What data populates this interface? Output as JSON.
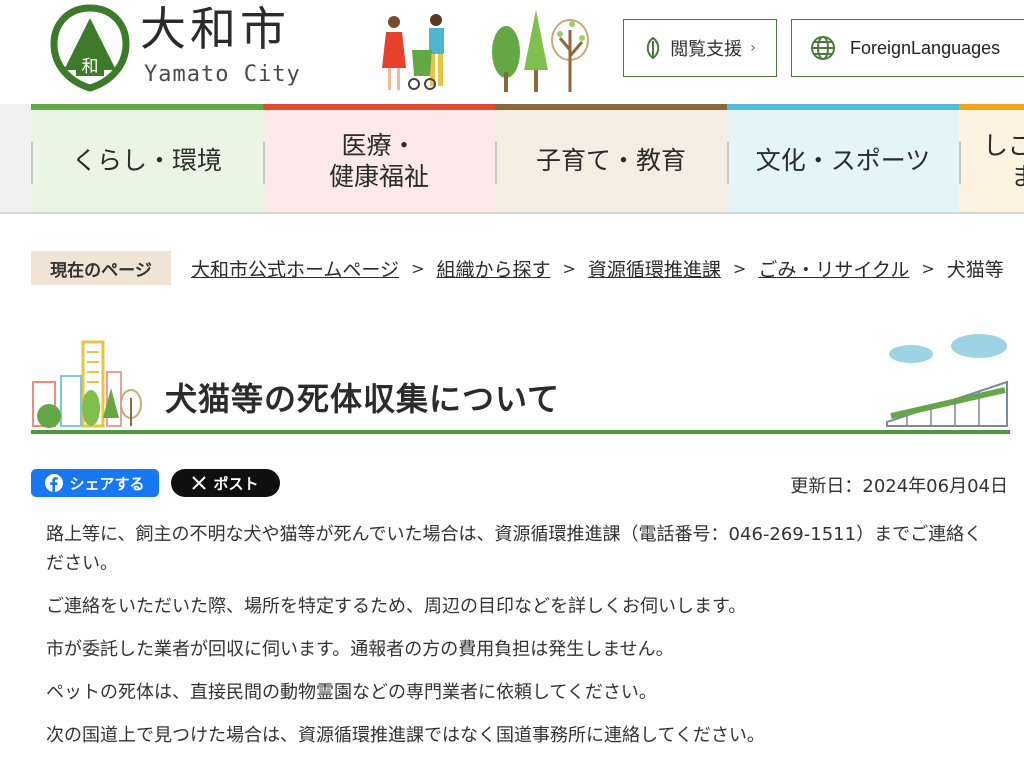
{
  "header": {
    "logo_ja": "大和市",
    "logo_en": "Yamato City",
    "logo_emblem_text": "和",
    "access_button": "閲覧支援",
    "foreign_button": "ForeignLanguages"
  },
  "nav": {
    "items": [
      {
        "line1": "くらし・環境",
        "line2": "",
        "bar": "#63a845",
        "bg": "#eaf6e4"
      },
      {
        "line1": "医療・",
        "line2": "健康福祉",
        "bar": "#e24b2f",
        "bg": "#fde9ea"
      },
      {
        "line1": "子育て・教育",
        "line2": "",
        "bar": "#8a6a3a",
        "bg": "#f5ece2"
      },
      {
        "line1": "文化・スポーツ",
        "line2": "",
        "bar": "#55b9d8",
        "bg": "#e4f4fb"
      },
      {
        "line1": "しご",
        "line2": "ま",
        "bar": "#f3a51c",
        "bg": "#fdf3e0"
      }
    ]
  },
  "breadcrumb": {
    "label": "現在のページ",
    "items": [
      "大和市公式ホームページ",
      "組織から探す",
      "資源循環推進課",
      "ごみ・リサイクル",
      "犬猫等"
    ]
  },
  "page": {
    "title": "犬猫等の死体収集について",
    "updated": "更新日：2024年06月04日"
  },
  "share": {
    "facebook": "シェアする",
    "x": "ポスト"
  },
  "content": {
    "paragraphs": [
      "路上等に、飼主の不明な犬や猫等が死んでいた場合は、資源循環推進課（電話番号：046-269-1511）までご連絡ください。",
      "ご連絡をいただいた際、場所を特定するため、周辺の目印などを詳しくお伺いします。",
      "市が委託した業者が回収に伺います。通報者の方の費用負担は発生しません。",
      "ペットの死体は、直接民間の動物霊園などの専門業者に依頼してください。",
      "次の国道上で見つけた場合は、資源循環推進課ではなく国道事務所に連絡してください。"
    ]
  },
  "colors": {
    "brand_green": "#3d7a2a",
    "title_rule": "#4d9a3b",
    "facebook": "#1877f2",
    "x": "#0f0f0f"
  }
}
